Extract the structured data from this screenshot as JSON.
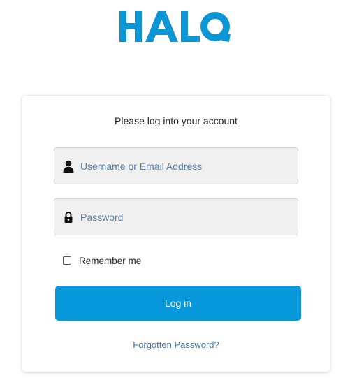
{
  "brand": {
    "logo_text": "HALO",
    "color": "#0c96d6"
  },
  "login": {
    "heading": "Please log into your account",
    "username": {
      "placeholder": "Username or Email Address",
      "value": "",
      "icon": "user-icon"
    },
    "password": {
      "placeholder": "Password",
      "value": "",
      "icon": "lock-icon"
    },
    "remember_label": "Remember me",
    "remember_checked": false,
    "submit_label": "Log in",
    "forgot_label": "Forgotten Password?"
  },
  "colors": {
    "button": "#0798dc",
    "link": "#3f76b0",
    "placeholder": "#5b7fa6"
  }
}
